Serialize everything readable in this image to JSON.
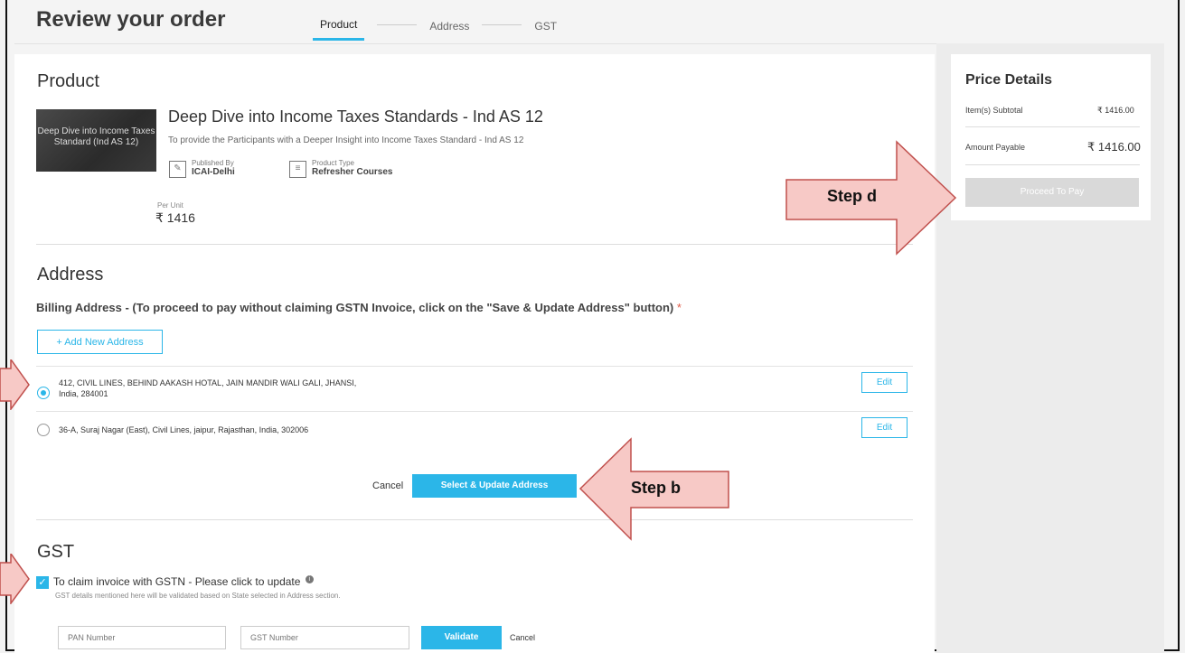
{
  "header": {
    "title": "Review your order",
    "steps": [
      "Product",
      "Address",
      "GST"
    ]
  },
  "product": {
    "section_title": "Product",
    "thumb_text": "Deep Dive into Income Taxes Standard (Ind AS 12)",
    "name": "Deep Dive into Income Taxes Standards - Ind AS 12",
    "description": "To provide the Participants with a Deeper Insight into Income Taxes Standard - Ind AS 12",
    "published_by_label": "Published By",
    "published_by": "ICAI-Delhi",
    "product_type_label": "Product Type",
    "product_type": "Refresher Courses",
    "per_unit_label": "Per Unit",
    "per_unit_price": "₹ 1416"
  },
  "address": {
    "section_title": "Address",
    "billing_label": "Billing Address - (To proceed to pay without claiming GSTN Invoice, click on the \"Save & Update Address\" button)",
    "required_mark": "*",
    "add_button": "+ Add New Address",
    "items": [
      {
        "line1": "412, CIVIL LINES, BEHIND AAKASH HOTAL, JAIN MANDIR WALI GALI, JHANSI,",
        "line2": "India, 284001",
        "selected": true,
        "edit": "Edit"
      },
      {
        "line1": "36-A, Suraj Nagar (East), Civil Lines, jaipur, Rajasthan, India, 302006",
        "line2": "",
        "selected": false,
        "edit": "Edit"
      }
    ],
    "cancel": "Cancel",
    "select_update": "Select & Update Address"
  },
  "gst": {
    "section_title": "GST",
    "claim_label": "To claim invoice with GSTN - Please click to update",
    "note": "GST details mentioned here will be validated based on State selected in Address section.",
    "pan_placeholder": "PAN Number",
    "gst_placeholder": "GST Number",
    "validate": "Validate",
    "cancel": "Cancel",
    "checked": true
  },
  "price": {
    "title": "Price Details",
    "subtotal_label": "Item(s) Subtotal",
    "subtotal_value": "₹ 1416.00",
    "payable_label": "Amount Payable",
    "payable_value": "₹ 1416.00",
    "pay_button": "Proceed To Pay"
  },
  "annotations": {
    "step_b": "Step b",
    "step_d": "Step d"
  },
  "colors": {
    "accent": "#2bb6e8",
    "callout_fill": "#f7c9c6",
    "callout_border": "#c0504d"
  }
}
